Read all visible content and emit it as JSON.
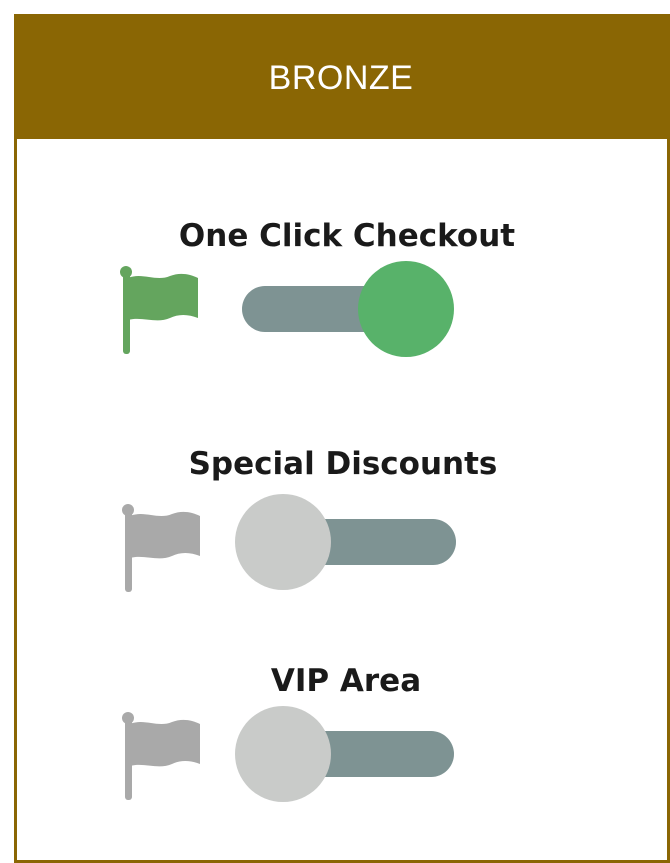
{
  "tier": {
    "title": "BRONZE",
    "accent_color": "#8a6604"
  },
  "features": [
    {
      "label": "One Click Checkout",
      "enabled": true,
      "flag_icon": "flag-icon",
      "flag_color": "#64a55e",
      "knob_color": "#58b26a"
    },
    {
      "label": "Special Discounts",
      "enabled": false,
      "flag_icon": "flag-icon",
      "flag_color": "#a9a9a9",
      "knob_color": "#c9cbc9"
    },
    {
      "label": "VIP Area",
      "enabled": false,
      "flag_icon": "flag-icon",
      "flag_color": "#a9a9a9",
      "knob_color": "#c9cbc9"
    }
  ],
  "track_color": "#7e9393"
}
